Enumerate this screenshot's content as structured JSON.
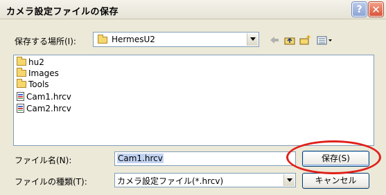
{
  "window": {
    "title": "カメラ設定ファイルの保存",
    "help_label": "?",
    "close_label": "✕"
  },
  "save_in": {
    "label": "保存する場所(I):",
    "value": "HermesU2"
  },
  "files": [
    {
      "name": "hu2",
      "type": "folder"
    },
    {
      "name": "Images",
      "type": "folder"
    },
    {
      "name": "Tools",
      "type": "folder"
    },
    {
      "name": "Cam1.hrcv",
      "type": "file"
    },
    {
      "name": "Cam2.hrcv",
      "type": "file"
    }
  ],
  "filename": {
    "label": "ファイル名(N):",
    "value": "Cam1.hrcv"
  },
  "filetype": {
    "label": "ファイルの種類(T):",
    "value": "カメラ設定ファイル(*.hrcv)"
  },
  "buttons": {
    "save": "保存(S)",
    "cancel": "キャンセル"
  },
  "icons": {
    "back": "back-arrow-icon",
    "up": "up-folder-icon",
    "new_folder": "new-folder-icon",
    "view_menu": "view-menu-icon"
  },
  "colors": {
    "dialog_bg": "#ece9d8",
    "border": "#7f9db9",
    "highlight": "#e0201a"
  }
}
